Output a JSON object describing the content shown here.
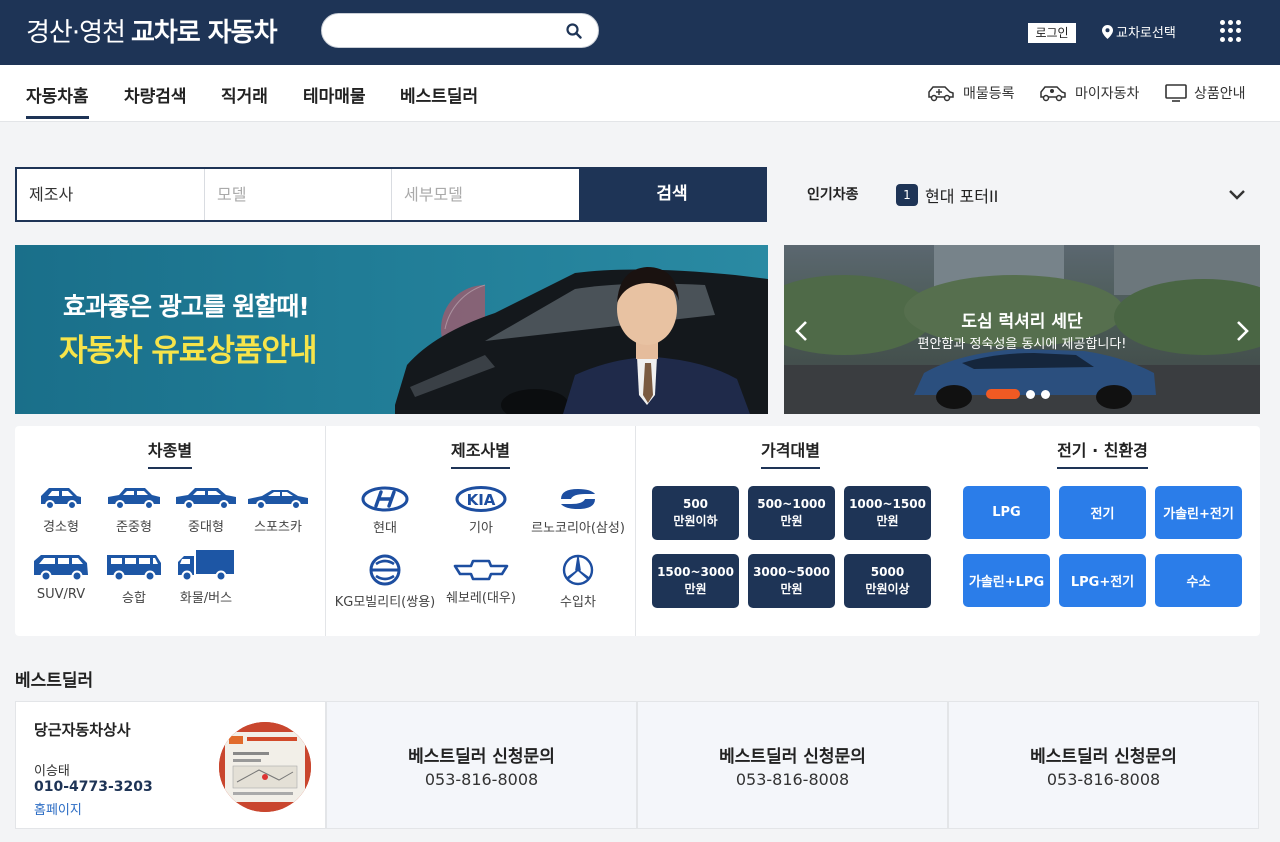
{
  "header": {
    "logo_region": "경산·영천",
    "logo_brand": "교차로 자동차",
    "search_placeholder": "",
    "login_label": "로그인",
    "region_label": "교차로선택"
  },
  "nav": {
    "items": [
      {
        "label": "자동차홈",
        "active": true
      },
      {
        "label": "차량검색"
      },
      {
        "label": "직거래"
      },
      {
        "label": "테마매물"
      },
      {
        "label": "베스트딜러"
      }
    ],
    "right": [
      {
        "label": "매물등록",
        "icon": "car-register-icon"
      },
      {
        "label": "마이자동차",
        "icon": "my-car-icon"
      },
      {
        "label": "상품안내",
        "icon": "monitor-icon"
      }
    ]
  },
  "search": {
    "maker": "제조사",
    "model_placeholder": "모델",
    "submodel_placeholder": "세부모델",
    "button": "검색"
  },
  "popular": {
    "label": "인기차종",
    "rank": "1",
    "car": "현대 포터II"
  },
  "banner_left": {
    "line1": "효과좋은 광고를 원할때!",
    "line2": "자동차 유료상품안내"
  },
  "banner_right": {
    "title": "도심 럭셔리 세단",
    "subtitle": "편안함과 정숙성을 동시에 제공합니다!",
    "slide_index": 1,
    "slide_count": 3
  },
  "categories": {
    "by_type": {
      "title": "차종별",
      "items": [
        "경소형",
        "준중형",
        "중대형",
        "스포츠카",
        "SUV/RV",
        "승합",
        "화물/버스"
      ]
    },
    "by_maker": {
      "title": "제조사별",
      "items": [
        "현대",
        "기아",
        "르노코리아(삼성)",
        "KG모빌리티(쌍용)",
        "쉐보레(대우)",
        "수입차"
      ]
    },
    "by_price": {
      "title": "가격대별",
      "items": [
        {
          "l1": "500",
          "l2": "만원이하"
        },
        {
          "l1": "500~1000",
          "l2": "만원"
        },
        {
          "l1": "1000~1500",
          "l2": "만원"
        },
        {
          "l1": "1500~3000",
          "l2": "만원"
        },
        {
          "l1": "3000~5000",
          "l2": "만원"
        },
        {
          "l1": "5000",
          "l2": "만원이상"
        }
      ]
    },
    "by_fuel": {
      "title": "전기 · 친환경",
      "items": [
        "LPG",
        "전기",
        "가솔린+전기",
        "가솔린+LPG",
        "LPG+전기",
        "수소"
      ]
    }
  },
  "best_dealer": {
    "heading": "베스트딜러",
    "dealer": {
      "name": "당근자동차상사",
      "person": "이승태",
      "phone": "010-4773-3203",
      "homepage": "홈페이지"
    },
    "apply_title": "베스트딜러 신청문의",
    "apply_phone": "053-816-8008"
  },
  "colors": {
    "navy": "#1e3456",
    "blue": "#2b7de9",
    "accent_orange": "#f05a23",
    "banner_yellow": "#f7e44a"
  }
}
